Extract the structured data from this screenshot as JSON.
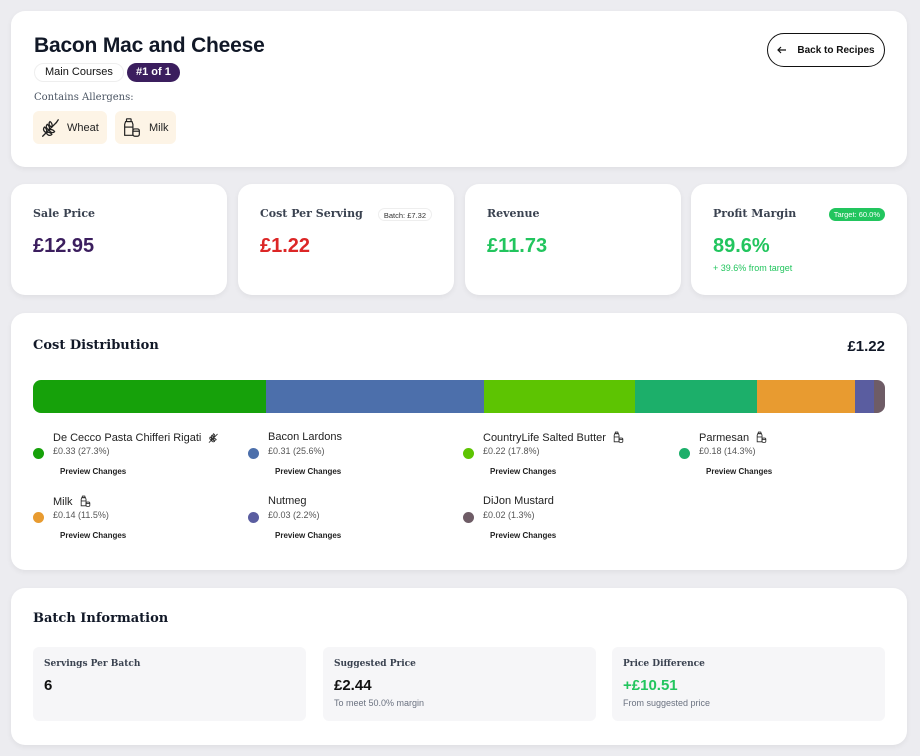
{
  "recipe": {
    "title": "Bacon Mac and Cheese",
    "category": "Main Courses",
    "rank": "#1 of 1",
    "allergens_label": "Contains Allergens:",
    "allergens": [
      {
        "name": "Wheat",
        "icon": "wheat-icon"
      },
      {
        "name": "Milk",
        "icon": "milk-icon"
      }
    ],
    "back_button": "Back to Recipes"
  },
  "stats": {
    "sale_price": {
      "label": "Sale Price",
      "value": "£12.95",
      "color": "#3b1e5e"
    },
    "cost_per_serving": {
      "label": "Cost Per Serving",
      "value": "£1.22",
      "badge": "Batch: £7.32",
      "color": "#dc2626"
    },
    "revenue": {
      "label": "Revenue",
      "value": "£11.73",
      "color": "#22c55e"
    },
    "profit_margin": {
      "label": "Profit Margin",
      "value": "89.6%",
      "badge": "Target: 60.0%",
      "sub": "+ 39.6% from target",
      "color": "#22c55e"
    }
  },
  "cost_distribution": {
    "title": "Cost Distribution",
    "total": "£1.22",
    "preview_label": "Preview Changes",
    "items": [
      {
        "name": "De Cecco Pasta Chifferi Rigati",
        "cost": "£0.33 (27.3%)",
        "percent": 27.3,
        "color": "#16a10a",
        "allergen": "wheat"
      },
      {
        "name": "Bacon Lardons",
        "cost": "£0.31 (25.6%)",
        "percent": 25.6,
        "color": "#4c6fab",
        "allergen": ""
      },
      {
        "name": "CountryLife Salted Butter",
        "cost": "£0.22 (17.8%)",
        "percent": 17.8,
        "color": "#5dc402",
        "allergen": "milk"
      },
      {
        "name": "Parmesan",
        "cost": "£0.18 (14.3%)",
        "percent": 14.3,
        "color": "#1caf6a",
        "allergen": "milk"
      },
      {
        "name": "Milk",
        "cost": "£0.14 (11.5%)",
        "percent": 11.5,
        "color": "#e89b30",
        "allergen": "milk"
      },
      {
        "name": "Nutmeg",
        "cost": "£0.03 (2.2%)",
        "percent": 2.2,
        "color": "#5a5da0",
        "allergen": ""
      },
      {
        "name": "DiJon Mustard",
        "cost": "£0.02 (1.3%)",
        "percent": 1.3,
        "color": "#6e5c66",
        "allergen": ""
      }
    ]
  },
  "batch": {
    "title": "Batch Information",
    "servings": {
      "label": "Servings Per Batch",
      "value": "6"
    },
    "suggested": {
      "label": "Suggested Price",
      "value": "£2.44",
      "sub": "To meet 50.0% margin"
    },
    "difference": {
      "label": "Price Difference",
      "value": "+£10.51",
      "sub": "From suggested price",
      "color": "#22c55e"
    }
  }
}
